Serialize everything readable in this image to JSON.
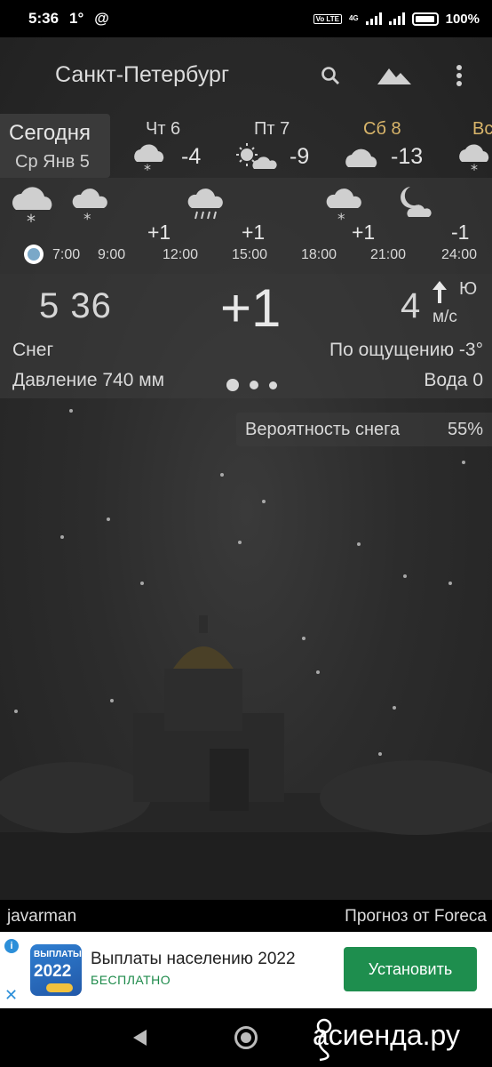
{
  "status_bar": {
    "time": "5:36",
    "temp": "1°",
    "at_symbol": "@",
    "volte": "Vo LTE",
    "network": "4G",
    "battery": "100%"
  },
  "toolbar": {
    "city": "Санкт-Петербург",
    "icons": [
      "search-icon",
      "landscape-icon",
      "more-vert-icon"
    ]
  },
  "days": {
    "today_label": "Сегодня",
    "today_date": "Ср Янв 5",
    "items": [
      {
        "label": "Чт 6",
        "temp": "-4",
        "icon": "cloud-snow-icon",
        "color": "#d8d8d8"
      },
      {
        "label": "Пт 7",
        "temp": "-9",
        "icon": "sun-cloud-icon",
        "color": "#d8d8d8"
      },
      {
        "label": "Сб 8",
        "temp": "-13",
        "icon": "cloud-icon",
        "color": "#d9b56a"
      },
      {
        "label": "Вс",
        "temp": "",
        "icon": "cloud-snow-icon",
        "color": "#d9b56a"
      }
    ]
  },
  "hourly": {
    "temps": [
      "+1",
      "+1",
      "+1",
      "-1"
    ],
    "times": [
      "7:00",
      "9:00",
      "12:00",
      "15:00",
      "18:00",
      "21:00",
      "24:00"
    ],
    "icons": [
      "cloud-snow-icon",
      "cloud-snow-icon",
      "cloud-rain-icon",
      "cloud-snow-icon",
      "moon-cloud-icon"
    ]
  },
  "current": {
    "clock": "5 36",
    "temp": "+1",
    "wind_speed": "4",
    "wind_dir": "Ю",
    "wind_unit": "м/с",
    "condition": "Снег",
    "feels_like": "По ощущению -3°",
    "pressure": "Давление 740 мм",
    "water": "Вода 0"
  },
  "snow_probability": {
    "label": "Вероятность снега",
    "value": "55%"
  },
  "footer": {
    "author": "javarman",
    "provider": "Прогноз от Foreca"
  },
  "ad": {
    "icon_line1": "ВЫПЛАТЫ",
    "icon_line2": "2022",
    "title": "Выплаты населению 2022",
    "subtitle": "БЕСПЛАТНО",
    "button": "Установить",
    "info_glyph": "i",
    "close_glyph": "✕"
  },
  "watermark": "асиенда.ру",
  "colors": {
    "accent_gold": "#d9b56a",
    "ad_green": "#1e8e4e",
    "now_dot": "#7aa8c8"
  }
}
